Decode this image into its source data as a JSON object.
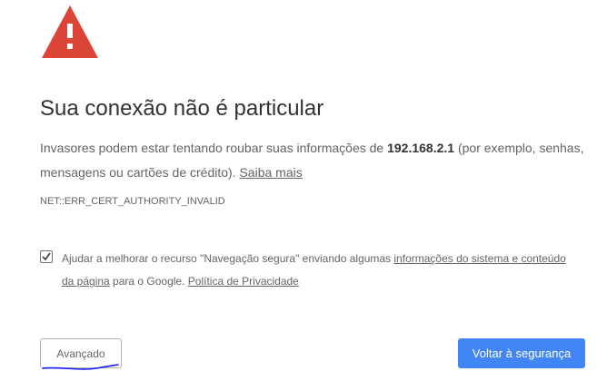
{
  "icon": {
    "name": "warning-triangle-icon",
    "color": "#db4437"
  },
  "main": {
    "title": "Sua conexão não é particular",
    "description": {
      "before": "Invasores podem estar tentando roubar suas informações de ",
      "host": "192.168.2.1",
      "after": " (por exemplo, senhas, mensagens ou cartões de crédito). ",
      "link": "Saiba mais"
    },
    "error_code": "NET::ERR_CERT_AUTHORITY_INVALID"
  },
  "safe_browsing": {
    "checked": true,
    "text_before": "Ajudar a melhorar o recurso \"Navegação segura\" enviando algumas ",
    "link1": "informações do sistema e conteúdo da página",
    "text_middle": " para o Google. ",
    "link2": "Política de Privacidade"
  },
  "buttons": {
    "advanced": "Avançado",
    "back_to_safety": "Voltar à segurança"
  },
  "colors": {
    "primary_button": "#4285f4",
    "scribble": "#1a1aff"
  }
}
